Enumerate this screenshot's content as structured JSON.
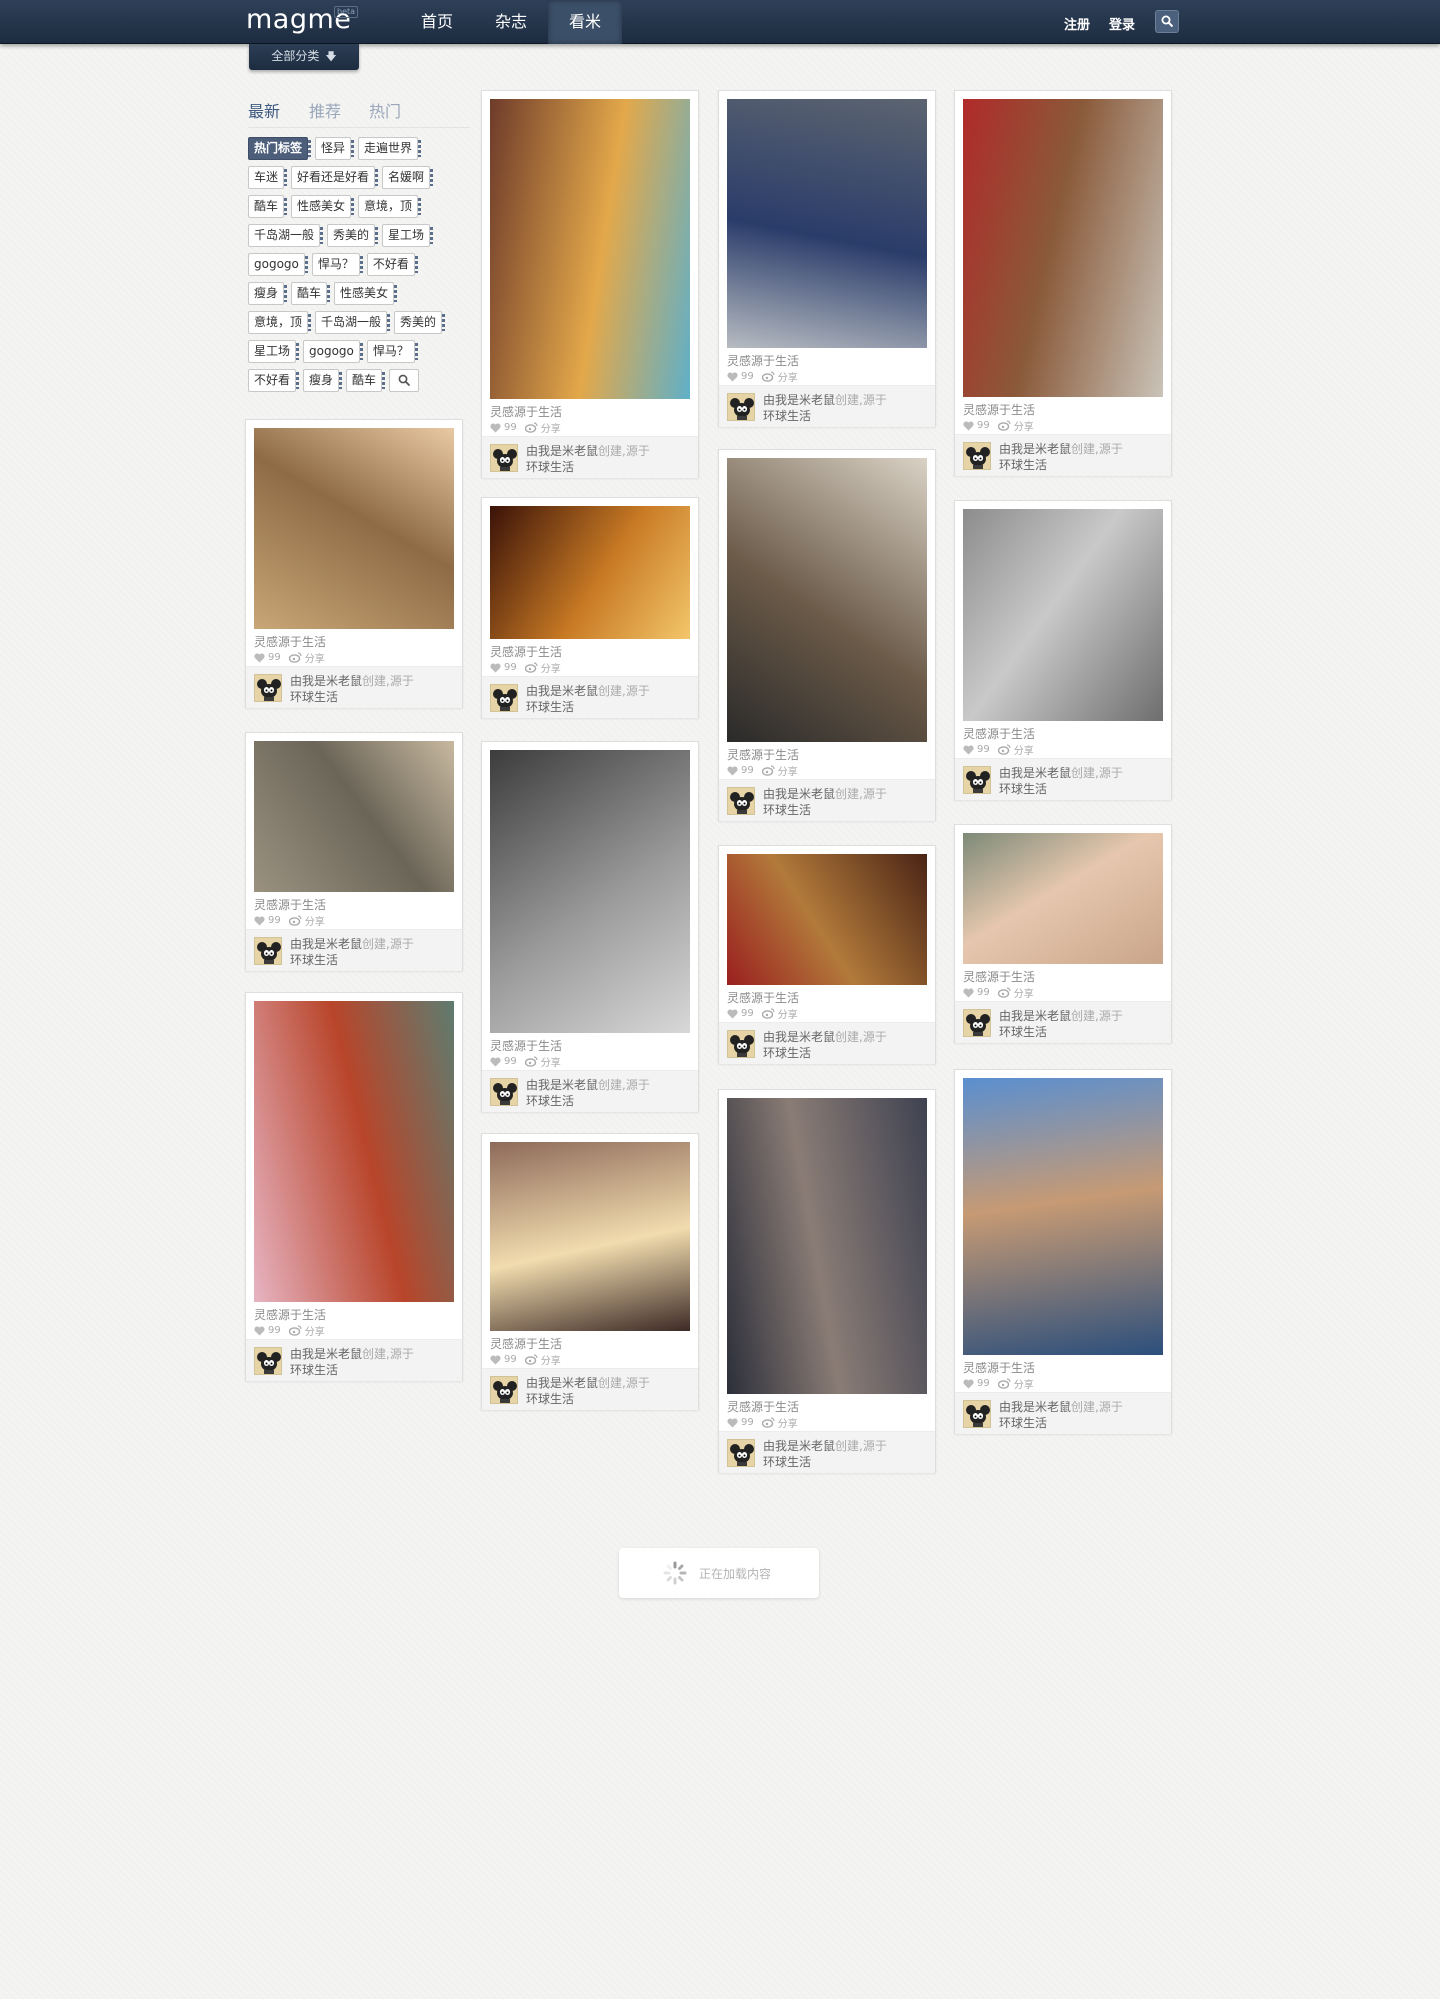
{
  "header": {
    "logo": "magme",
    "logo_badge": "beta",
    "nav": [
      "首页",
      "杂志",
      "看米"
    ],
    "register": "注册",
    "login": "登录",
    "category_tab": "全部分类",
    "category_arrow": "🡇"
  },
  "sidebar": {
    "filter_tabs": [
      "最新",
      "推荐",
      "热门"
    ],
    "hot_tag_label": "热门标签",
    "tags": [
      "怪异",
      "走遍世界",
      "车迷",
      "好看还是好看",
      "名媛啊",
      "酷车",
      "性感美女",
      "意境，顶",
      "千岛湖一般",
      "秀美的",
      "星工场",
      "gogogo",
      "悍马？",
      "不好看",
      "瘦身",
      "酷车",
      "性感美女",
      "意境，顶",
      "千岛湖一般",
      "秀美的",
      "星工场",
      "gogogo",
      "悍马？",
      "不好看",
      "瘦身",
      "酷车"
    ]
  },
  "card": {
    "title": "灵感源于生活",
    "likes": "99",
    "share": "分享",
    "footer_user": "由我是米老鼠",
    "footer_created": "创建,源于",
    "footer_board": "环球生活"
  },
  "loading": {
    "text": "正在加载内容"
  },
  "images": [
    "building-balcony-photo",
    "mailbox-photo",
    "lanterns-photo",
    "ice-cream-sandwich-photo",
    "globe-lamp-photo",
    "woman-bw-photo",
    "pillow-photo",
    "living-room-photo",
    "bathroom-bicycle-photo",
    "bookstore-photo",
    "woman-portrait-photo",
    "woman-street-photo",
    "ring-photo",
    "woman-flowers-photo",
    "woman-blue-mask-photo"
  ]
}
